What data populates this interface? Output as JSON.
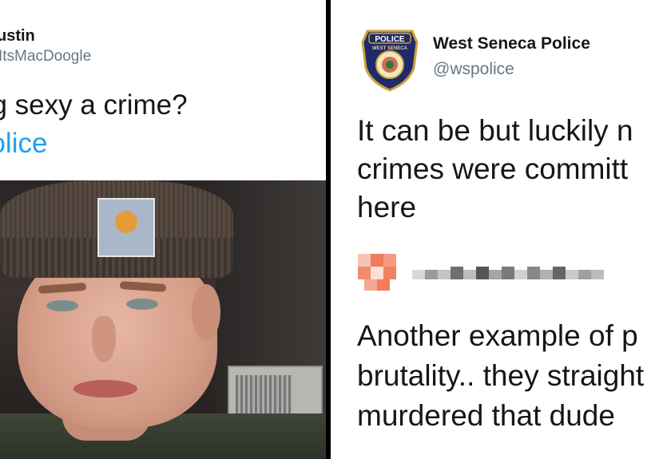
{
  "left_tweet": {
    "display_name": "ustin",
    "handle": "ItsMacDoogle",
    "text_line1": "ng sexy a crime?",
    "mention": "police"
  },
  "right_tweet": {
    "badge_text": "POLICE",
    "badge_subtext": "WEST SENECA",
    "display_name": "West Seneca Police",
    "handle": "@wspolice",
    "text_lines": [
      "It can be but luckily n",
      "crimes were committ",
      "here"
    ],
    "quoted_lines": [
      "Another example of p",
      "brutality.. they straight",
      "murdered that dude"
    ]
  },
  "colors": {
    "link": "#1da1f2",
    "handle": "#657786",
    "text": "#14171a"
  }
}
